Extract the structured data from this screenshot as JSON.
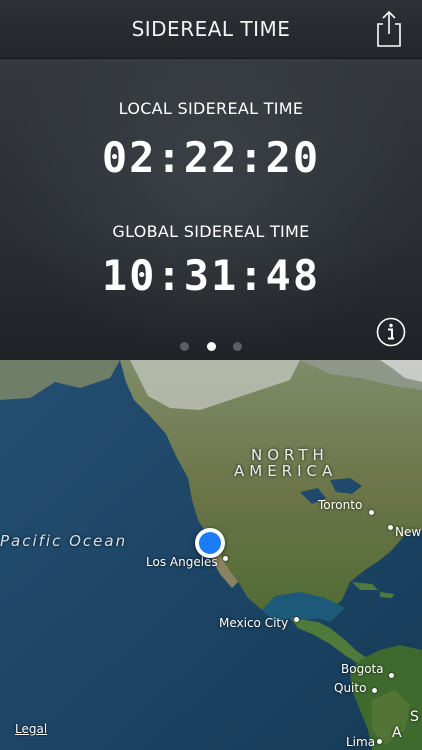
{
  "header": {
    "title": "SIDEREAL TIME",
    "share_icon": "share-icon"
  },
  "local": {
    "label": "LOCAL SIDEREAL TIME",
    "time": "02:22:20"
  },
  "global": {
    "label": "GLOBAL SIDEREAL TIME",
    "time": "10:31:48"
  },
  "pager": {
    "count": 3,
    "active_index": 1
  },
  "info_icon": "info-icon",
  "map": {
    "ocean_label": "Pacific Ocean",
    "continent_line1": "NORTH",
    "continent_line2": "AMERICA",
    "continent_sa_line1": "S",
    "continent_sa_line2": "A",
    "cities": {
      "toronto": "Toronto",
      "new_york": "New",
      "los_angeles": "Los Angeles",
      "mexico_city": "Mexico City",
      "bogota": "Bogota",
      "quito": "Quito",
      "lima": "Lima"
    },
    "legal": "Legal"
  },
  "colors": {
    "location_pin": "#1a7cf6",
    "ocean": "#1d4868",
    "land": "#5a6b3e"
  }
}
